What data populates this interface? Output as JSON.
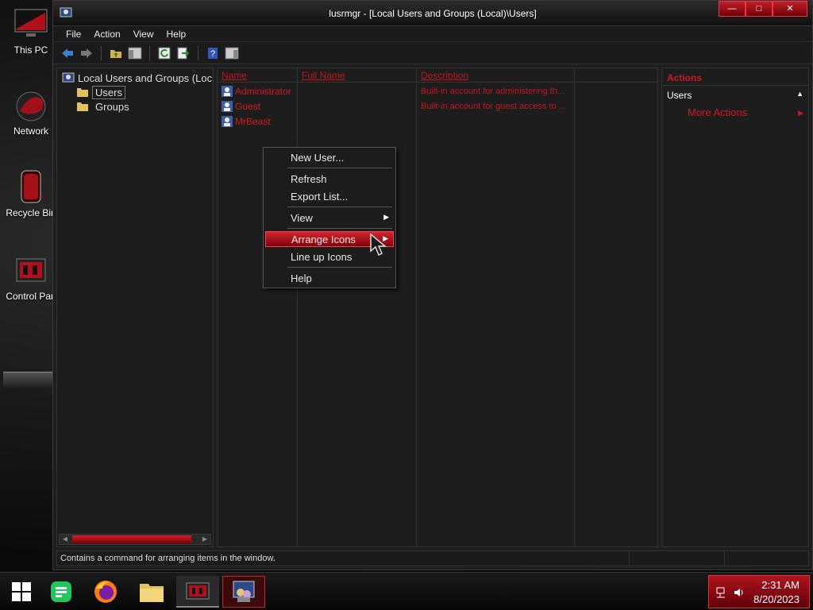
{
  "desktop": {
    "icons": [
      {
        "label": "This PC",
        "icon": "monitor-icon"
      },
      {
        "label": "Network",
        "icon": "network-icon"
      },
      {
        "label": "Recycle Bin",
        "icon": "recycle-bin-icon"
      },
      {
        "label": "Control Pan",
        "icon": "control-panel-icon"
      }
    ]
  },
  "window": {
    "title": "lusrmgr - [Local Users and Groups (Local)\\Users]",
    "menu": [
      "File",
      "Action",
      "View",
      "Help"
    ],
    "tree": {
      "root": "Local Users and Groups (Loc",
      "items": [
        "Users",
        "Groups"
      ]
    },
    "list": {
      "columns": [
        "Name",
        "Full Name",
        "Description"
      ],
      "rows": [
        {
          "name": "Administrator",
          "full_name": "",
          "description": "Built-in account for administering th..."
        },
        {
          "name": "Guest",
          "full_name": "",
          "description": "Built-in account for guest access to ..."
        },
        {
          "name": "MrBeast",
          "full_name": "",
          "description": ""
        }
      ]
    },
    "actions": {
      "header": "Actions",
      "section": "Users",
      "items": [
        "More Actions"
      ]
    },
    "status": "Contains a command for arranging items in the window."
  },
  "context_menu": {
    "items": [
      "New User...",
      "Refresh",
      "Export List...",
      "View",
      "Arrange Icons",
      "Line up Icons",
      "Help"
    ],
    "highlighted": "Arrange Icons"
  },
  "taskbar": {
    "time": "2:31 AM",
    "date": "8/20/2023",
    "accent": "#c0151f"
  }
}
